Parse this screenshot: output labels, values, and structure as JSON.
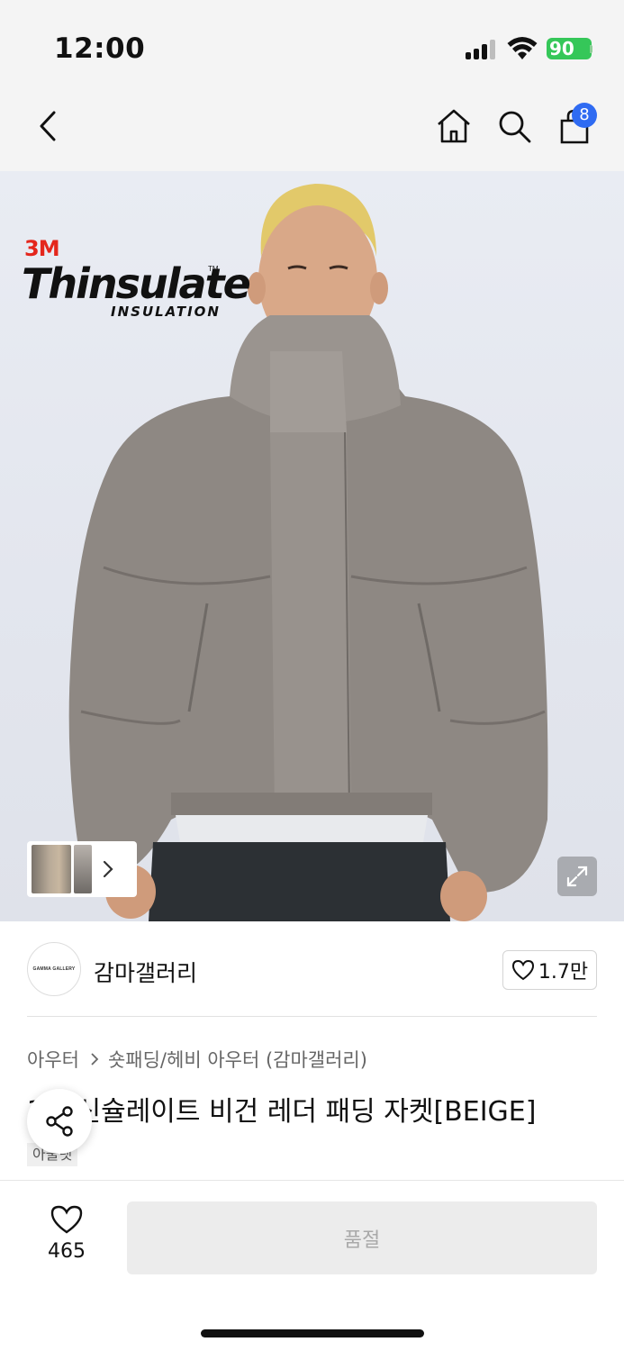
{
  "status_bar": {
    "time": "12:00",
    "battery": "90",
    "icons": [
      "signal-icon",
      "wifi-icon",
      "battery-icon"
    ]
  },
  "nav": {
    "icons": [
      "back-arrow-icon",
      "home-icon",
      "search-icon",
      "shopping-bag-icon"
    ],
    "cart_count": "8"
  },
  "hero": {
    "logo_brand": "3M",
    "logo_name": "Thinsulate",
    "logo_tm": "TM",
    "logo_tagline": "INSULATION",
    "thumbnail_count_icon": "chevron-right-icon",
    "expand_icon": "expand-icon"
  },
  "store": {
    "logo_text": "GAMMA GALLERY",
    "name": "감마갤러리",
    "likes": "1.7만"
  },
  "product": {
    "breadcrumb": [
      "아우터",
      "숏패딩/헤비 아우터 (감마갤러리)"
    ],
    "title": "3M 신슐레이트 비건 레더 패딩 자켓[BEIGE]",
    "tag": "아울렛"
  },
  "bottom_bar": {
    "wish_count": "465",
    "buy_label": "품절"
  },
  "colors": {
    "accent_blue": "#2f6bf2",
    "battery_green": "#35c759",
    "soldout_bg": "#ececec",
    "brand_red": "#e4261c"
  }
}
